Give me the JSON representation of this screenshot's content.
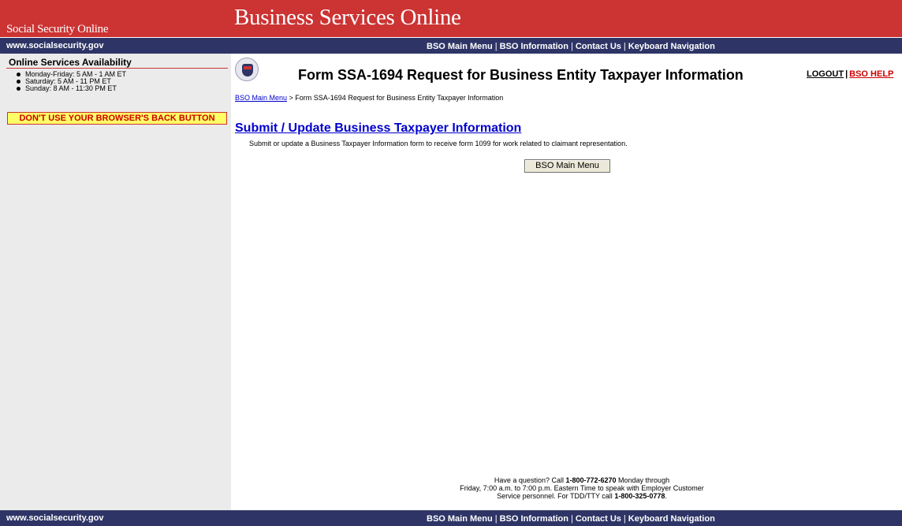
{
  "header": {
    "ssa_brand": "Social Security Online",
    "bso_title": "Business Services Online"
  },
  "nav": {
    "site": "www.socialsecurity.gov",
    "main_menu": "BSO Main Menu",
    "information": "BSO Information",
    "contact": "Contact Us",
    "keyboard": "Keyboard Navigation",
    "separator": "|"
  },
  "sidebar": {
    "availability_title": "Online Services Availability",
    "hours": [
      "Monday-Friday: 5 AM - 1 AM ET",
      "Saturday: 5 AM - 11 PM ET",
      "Sunday: 8 AM - 11:30 PM ET"
    ],
    "back_warning": "DON'T USE YOUR BROWSER'S BACK BUTTON"
  },
  "main": {
    "form_title": "Form SSA-1694 Request for Business Entity Taxpayer Information",
    "logout": "LOGOUT",
    "help": "BSO HELP",
    "breadcrumb_link": "BSO Main Menu",
    "breadcrumb_rest": " > Form SSA-1694 Request for Business Entity Taxpayer Information",
    "submit_link": "Submit / Update Business Taxpayer Information",
    "submit_desc": "Submit or update a Business Taxpayer Information form to receive form 1099 for work related to claimant representation.",
    "menu_button": "BSO Main Menu"
  },
  "footer": {
    "line1_pre": "Have a question? Call ",
    "phone": "1-800-772-6270",
    "line1_post": " Monday through",
    "line2": "Friday, 7:00 a.m. to 7:00 p.m. Eastern Time to speak with Employer Customer",
    "line3_pre": "Service personnel. For TDD/TTY call ",
    "tty": "1-800-325-0778",
    "line3_post": "."
  },
  "colors": {
    "header_red": "#cc3333",
    "nav_blue": "#2e3566",
    "link_blue": "#0000cc",
    "warning_yellow": "#ffff66"
  }
}
